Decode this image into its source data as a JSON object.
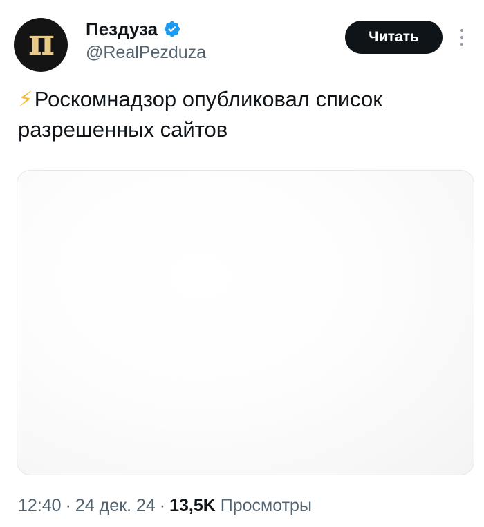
{
  "author": {
    "display_name": "Пездуза",
    "handle": "@RealPezduza",
    "avatar_glyph": "п",
    "verified": true,
    "verified_color": "#1d9bf0"
  },
  "actions": {
    "follow_label": "Читать",
    "more_icon": "more-vertical-icon"
  },
  "tweet": {
    "emoji": "⚡",
    "text": "Роскомнадзор опубликовал список разрешенных сайтов"
  },
  "meta": {
    "time": "12:40",
    "date": "24 дек. 24",
    "separator": "·",
    "views_count": "13,5K",
    "views_label": "Просмотры"
  }
}
